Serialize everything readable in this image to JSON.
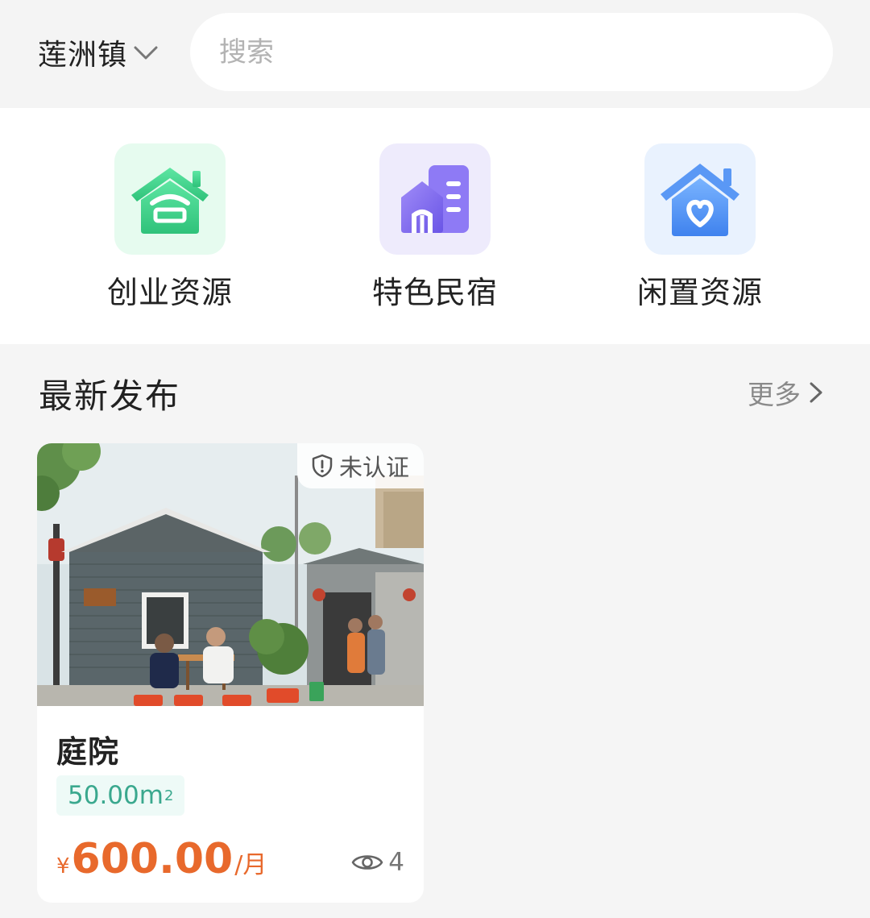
{
  "header": {
    "location": "莲洲镇",
    "search_placeholder": "搜索"
  },
  "categories": [
    {
      "label": "创业资源",
      "icon": "startup-house-icon",
      "color": "#3fd38a"
    },
    {
      "label": "特色民宿",
      "icon": "homestay-building-icon",
      "color": "#7b6cf0"
    },
    {
      "label": "闲置资源",
      "icon": "heart-house-icon",
      "color": "#4a8ff2"
    }
  ],
  "section": {
    "title": "最新发布",
    "more_label": "更多"
  },
  "listing": {
    "badge": "未认证",
    "title": "庭院",
    "area": "50.00m",
    "area_sup": "2",
    "price_currency": "¥",
    "price_value": "600.00",
    "price_unit": "/月",
    "views": "4"
  },
  "colors": {
    "price": "#e8692c",
    "area_tag_text": "#3aa88e",
    "background": "#f5f5f5"
  }
}
